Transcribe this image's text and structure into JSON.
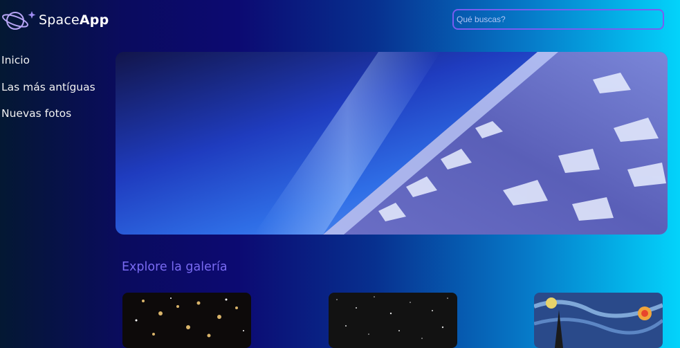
{
  "brand": {
    "name_light": "Space",
    "name_bold": "App",
    "icon": "planet-logo-icon"
  },
  "search": {
    "placeholder": "Qué buscas?",
    "value": ""
  },
  "sidebar": {
    "items": [
      {
        "label": "Inicio"
      },
      {
        "label": "Las más antíguas"
      },
      {
        "label": "Nuevas fotos"
      }
    ]
  },
  "banner": {
    "image": "earth-from-space-banner"
  },
  "gallery": {
    "title": "Explore la galería",
    "thumbnails": [
      {
        "image": "galaxy-cluster-photo"
      },
      {
        "image": "star-field-photo"
      },
      {
        "image": "starry-night-painting"
      }
    ]
  },
  "colors": {
    "accent": "#7a5cf0",
    "gallery_title": "#7a6bf3",
    "gradient_start": "#041833",
    "gradient_end": "#03d3fb"
  }
}
